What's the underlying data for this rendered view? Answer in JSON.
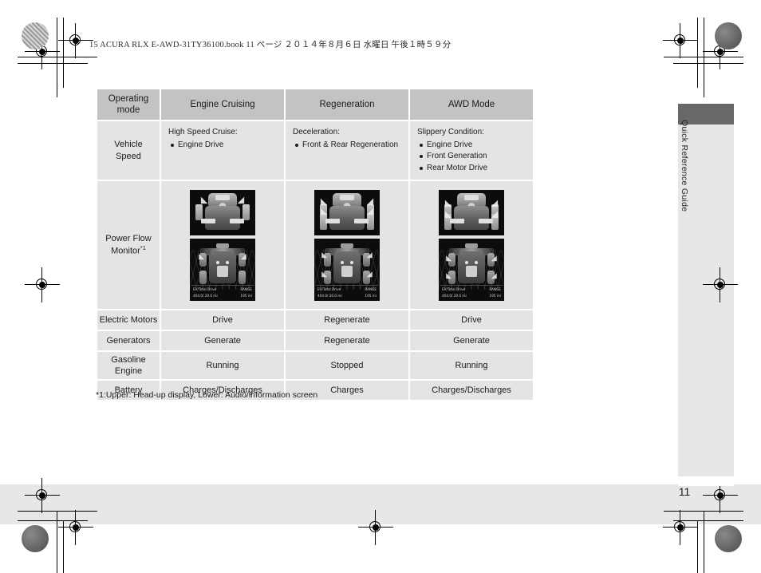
{
  "header": {
    "book_line": "15 ACURA RLX E-AWD-31TY36100.book   11 ページ   ２０１４年８月６日   水曜日   午後１時５９分"
  },
  "side_tab": {
    "label": "Quick Reference Guide"
  },
  "page": {
    "number": "11",
    "footnote": "*1:Upper: Head-up display, Lower: Audio/information screen"
  },
  "table": {
    "columns": [
      "Operating mode",
      "Engine Cruising",
      "Regeneration",
      "AWD Mode"
    ],
    "column_mode_line1": "Operating",
    "column_mode_line2": "mode",
    "rows": [
      {
        "label": "Vehicle Speed",
        "label_line1": "Vehicle",
        "label_line2": "Speed",
        "type": "bullets",
        "cells": [
          {
            "caption": "High Speed Cruise:",
            "items": [
              "Engine Drive"
            ]
          },
          {
            "caption": "Deceleration:",
            "items": [
              "Front & Rear Regeneration"
            ]
          },
          {
            "caption": "Slippery Condition:",
            "items": [
              "Engine Drive",
              "Front Generation",
              "Rear Motor Drive"
            ]
          }
        ]
      },
      {
        "label": "Power Flow Monitor",
        "label_line1": "Power Flow",
        "label_line2": "Monitor",
        "label_sup": "*1",
        "type": "images",
        "cells": [
          {
            "hud_alt": "head-up-display-engine-cruising",
            "audio_alt": "audio-screen-engine-cruising",
            "display_left_title": "EV/Total Drive",
            "display_left_value": "404.0/ 20.0 mi",
            "display_right_title": "RANGE",
            "display_right_value": "195 mi"
          },
          {
            "hud_alt": "head-up-display-regeneration",
            "audio_alt": "audio-screen-regeneration",
            "display_left_title": "EV/Total Drive",
            "display_left_value": "404.0/ 20.0 mi",
            "display_right_title": "RANGE",
            "display_right_value": "195 mi"
          },
          {
            "hud_alt": "head-up-display-awd-mode",
            "audio_alt": "audio-screen-awd-mode",
            "display_left_title": "EV/Total Drive",
            "display_left_value": "404.0/ 20.0 mi",
            "display_right_title": "RANGE",
            "display_right_value": "195 mi"
          }
        ]
      },
      {
        "label": "Electric Motors",
        "type": "text",
        "cells": [
          "Drive",
          "Regenerate",
          "Drive"
        ]
      },
      {
        "label": "Generators",
        "type": "text",
        "cells": [
          "Generate",
          "Regenerate",
          "Generate"
        ]
      },
      {
        "label": "Gasoline Engine",
        "label_line1": "Gasoline",
        "label_line2": "Engine",
        "type": "text",
        "cells": [
          "Running",
          "Stopped",
          "Running"
        ]
      },
      {
        "label": "Battery",
        "type": "text",
        "cells": [
          "Charges/Discharges",
          "Charges",
          "Charges/Discharges"
        ]
      }
    ]
  },
  "colors": {
    "header_cell": "#c3c3c3",
    "body_cell": "#e4e4e4",
    "band": "#e7e7e7",
    "tab_dark": "#686868",
    "text": "#1c1c1c"
  }
}
